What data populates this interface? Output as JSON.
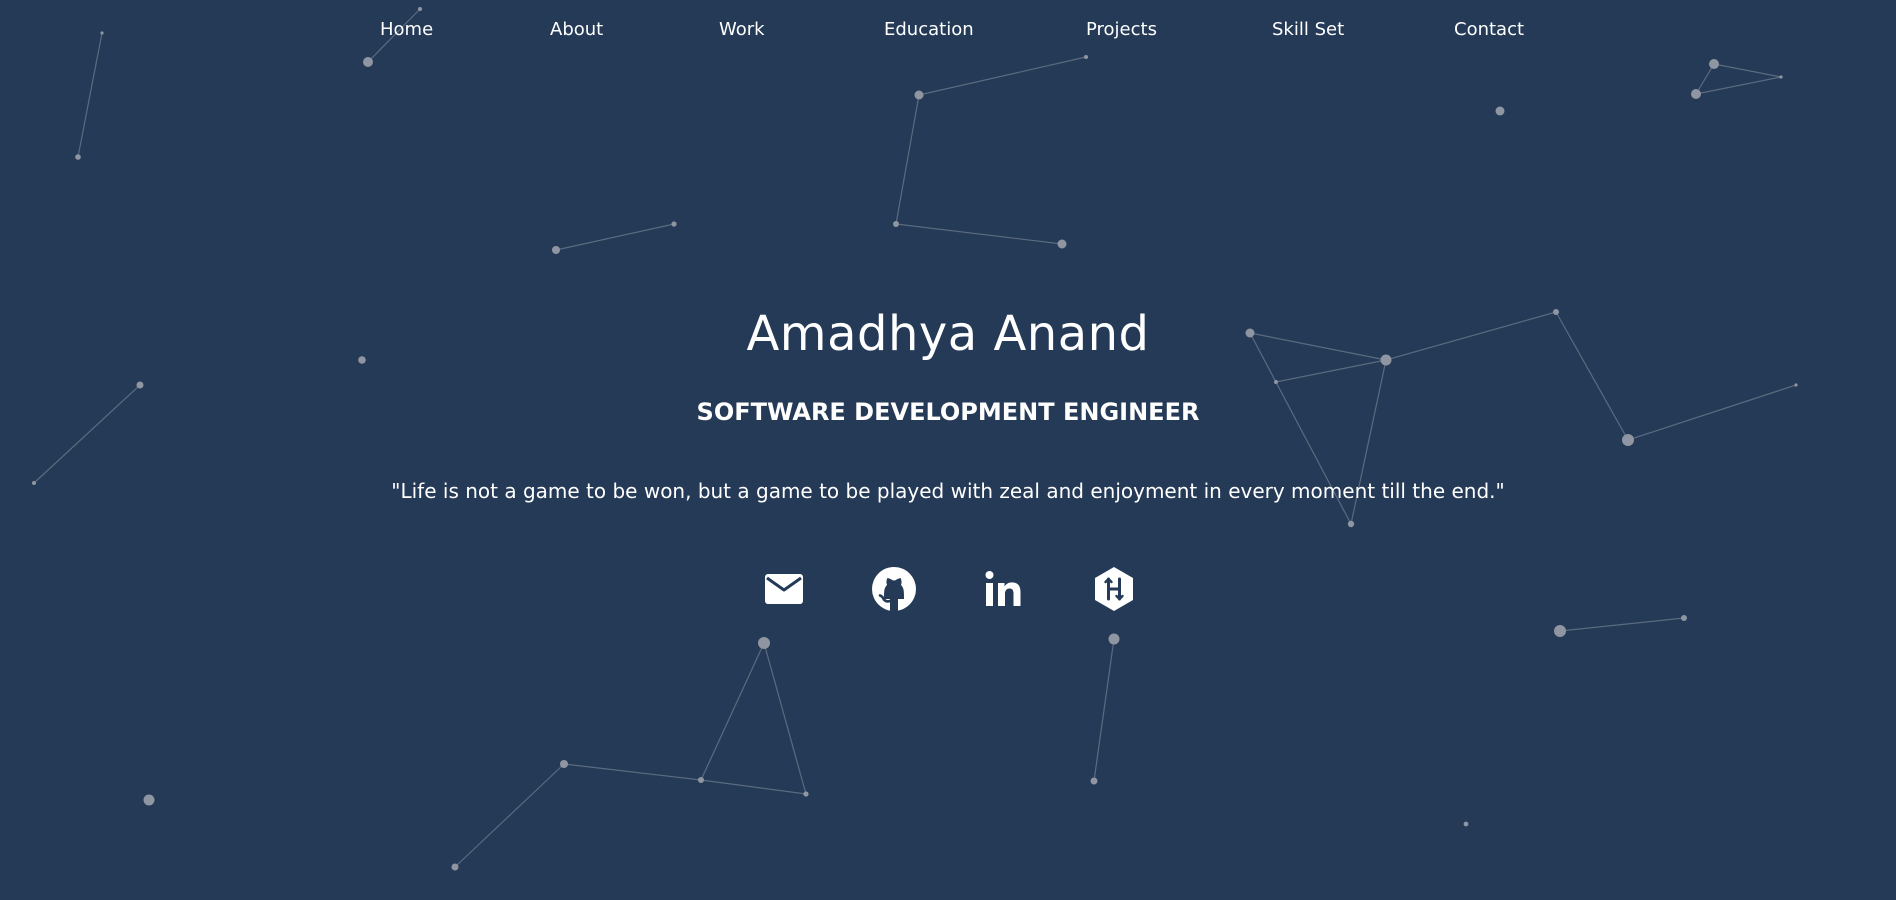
{
  "nav": {
    "items": [
      {
        "label": "Home"
      },
      {
        "label": "About"
      },
      {
        "label": "Work"
      },
      {
        "label": "Education"
      },
      {
        "label": "Projects"
      },
      {
        "label": "Skill Set"
      },
      {
        "label": "Contact"
      }
    ]
  },
  "hero": {
    "name": "Amadhya Anand",
    "title": "SOFTWARE DEVELOPMENT ENGINEER",
    "quote": "\"Life is not a game to be won, but a game to be played with zeal and enjoyment in every moment till the end.\""
  },
  "social": [
    {
      "icon": "mail-icon"
    },
    {
      "icon": "github-icon"
    },
    {
      "icon": "linkedin-icon"
    },
    {
      "icon": "hackerrank-icon"
    }
  ],
  "colors": {
    "background": "#243a56",
    "text": "#ffffff",
    "particle": "#8f96a1"
  }
}
